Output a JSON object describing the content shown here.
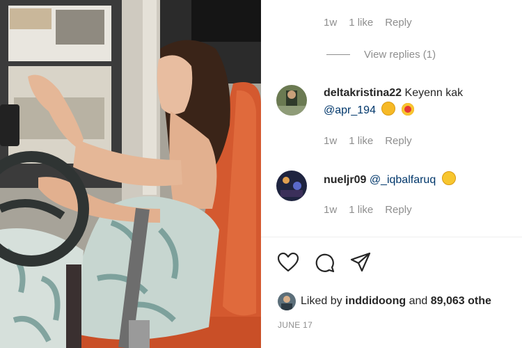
{
  "photo": {
    "description_icon": "video-frame"
  },
  "comments": [
    {
      "time": "1w",
      "likes": "1 like",
      "reply": "Reply"
    },
    {
      "username": "deltakristina22",
      "text": "Keyenn kak",
      "mention": "@apr_194",
      "emojis": [
        "clapping-hands",
        "star-struck"
      ],
      "time": "1w",
      "likes": "1 like",
      "reply": "Reply"
    },
    {
      "username": "nueljr09",
      "text": "",
      "mention": "@_iqbalfaruq",
      "emojis": [
        "tears-of-joy"
      ],
      "time": "1w",
      "likes": "1 like",
      "reply": "Reply"
    }
  ],
  "view_replies": "View replies (1)",
  "actions": {
    "like_icon": "heart-icon",
    "comment_icon": "comment-icon",
    "share_icon": "share-icon"
  },
  "liked_by": {
    "prefix": "Liked by",
    "user": "inddidoong",
    "connector": "and",
    "count_text": "89,063 othe"
  },
  "date": "JUNE 17",
  "colors": {
    "mention": "#00376b",
    "muted": "#8e8e8e",
    "seat": "#d4592f"
  }
}
